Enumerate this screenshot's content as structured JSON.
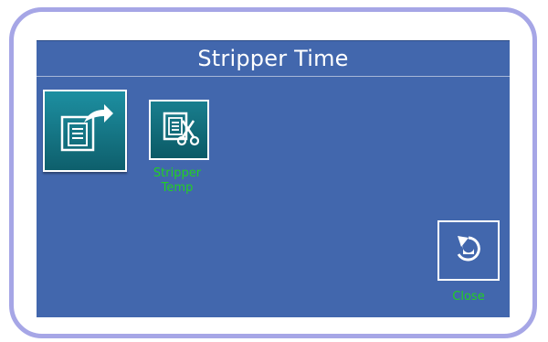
{
  "screen": {
    "title": "Stripper Time"
  },
  "buttons": {
    "export": {
      "icon": "document-export-icon"
    },
    "stripper_temp": {
      "icon": "document-scissors-icon",
      "label_line1": "Stripper",
      "label_line2": "Temp"
    },
    "close": {
      "icon": "undo-icon",
      "label": "Close"
    }
  },
  "colors": {
    "screen_bg": "#4267ad",
    "bezel": "#a6a6e6",
    "button_teal": "#13707f",
    "label_green": "#22d022",
    "title_text": "#ffffff"
  }
}
